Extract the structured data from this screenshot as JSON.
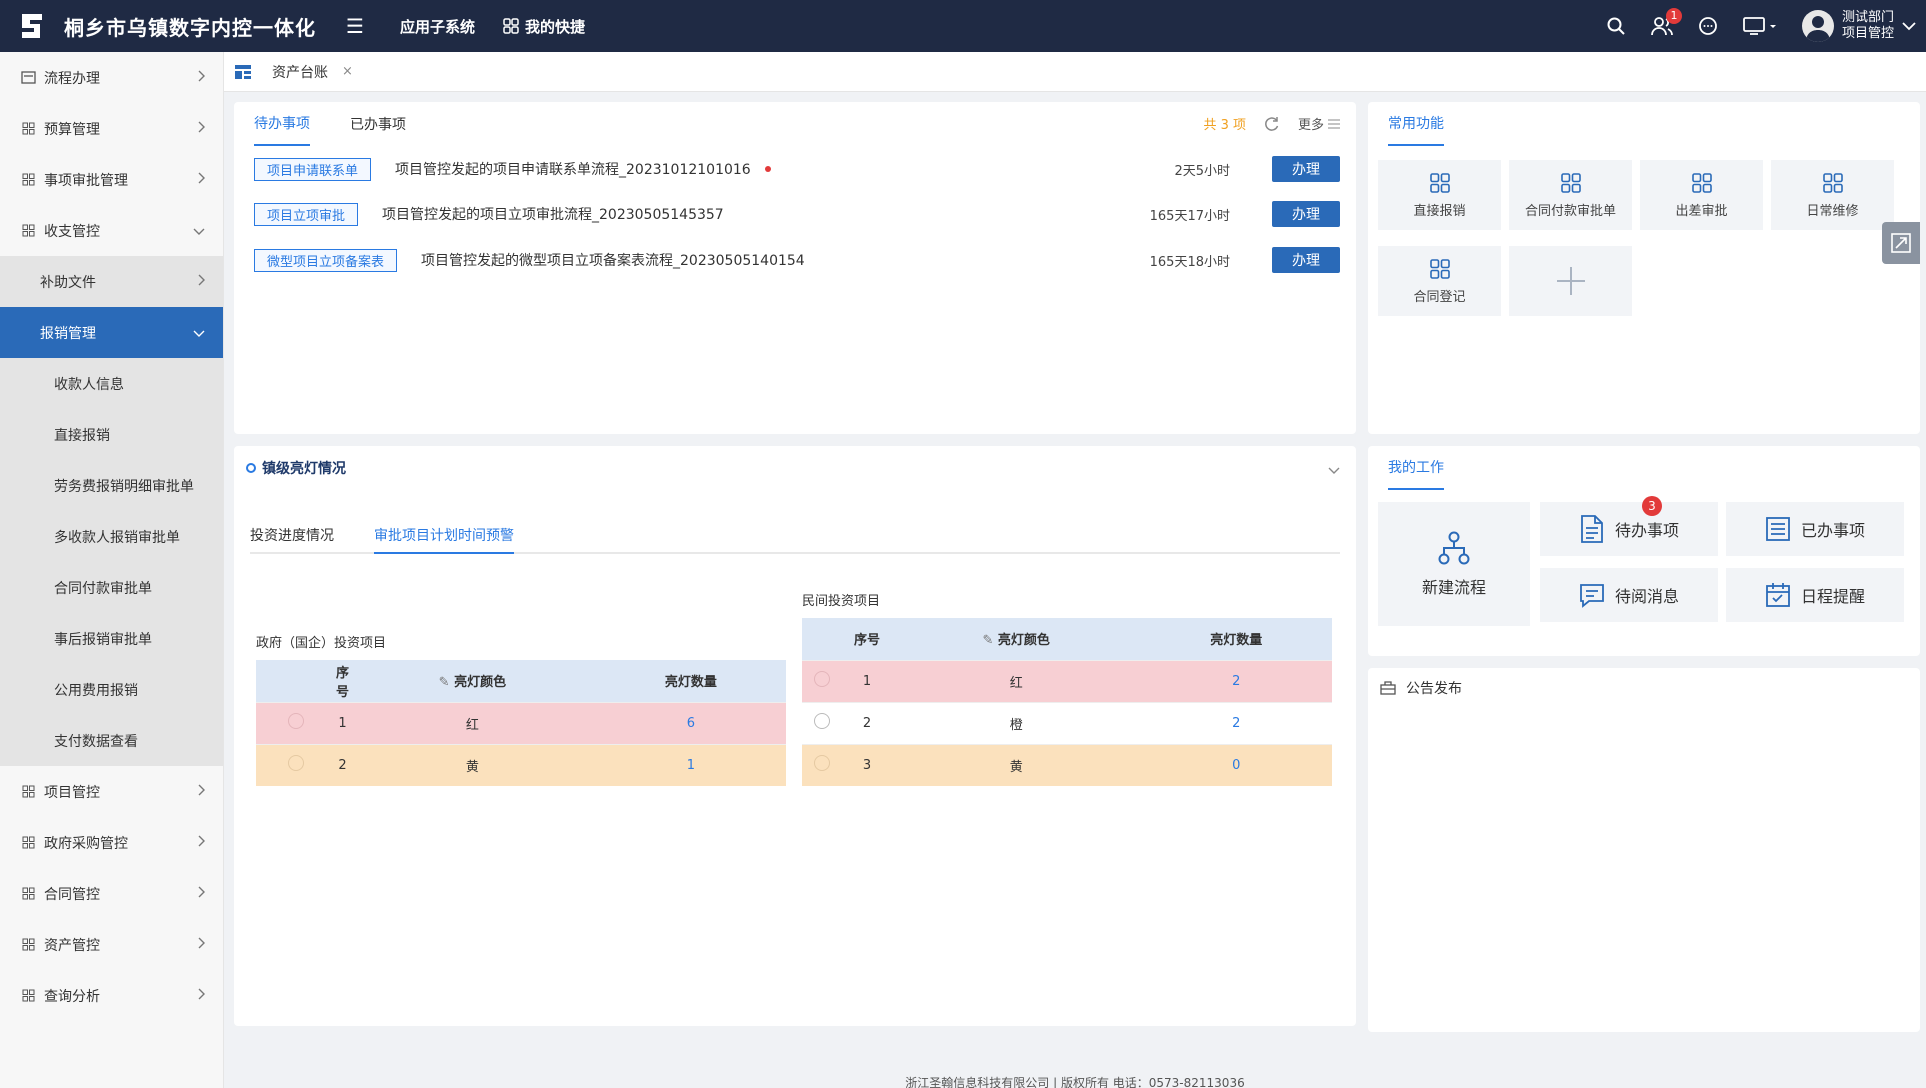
{
  "header": {
    "app_title": "桐乡市乌镇数字内控一体化",
    "nav": [
      "应用子系统",
      "我的快捷"
    ],
    "notification_count": "1",
    "user_dept": "测试部门",
    "user_role": "项目管控"
  },
  "sidebar": {
    "items": [
      {
        "label": "流程办理"
      },
      {
        "label": "预算管理"
      },
      {
        "label": "事项审批管理"
      },
      {
        "label": "收支管控"
      },
      {
        "label": "补助文件"
      },
      {
        "label": "报销管理"
      },
      {
        "label": "收款人信息"
      },
      {
        "label": "直接报销"
      },
      {
        "label": "劳务费报销明细审批单"
      },
      {
        "label": "多收款人报销审批单"
      },
      {
        "label": "合同付款审批单"
      },
      {
        "label": "事后报销审批单"
      },
      {
        "label": "公用费用报销"
      },
      {
        "label": "支付数据查看"
      },
      {
        "label": "项目管控"
      },
      {
        "label": "政府采购管控"
      },
      {
        "label": "合同管控"
      },
      {
        "label": "资产管控"
      },
      {
        "label": "查询分析"
      }
    ]
  },
  "tabbar": {
    "tab_label": "资产台账",
    "close": "×"
  },
  "todo": {
    "tabs": [
      "待办事项",
      "已办事项"
    ],
    "count_text": "共 3 项",
    "more": "更多",
    "rows": [
      {
        "tag": "项目申请联系单",
        "text": "项目管控发起的项目申请联系单流程_20231012101016",
        "time": "2天5小时",
        "action": "办理"
      },
      {
        "tag": "项目立项审批",
        "text": "项目管控发起的项目立项审批流程_20230505145357",
        "time": "165天17小时",
        "action": "办理"
      },
      {
        "tag": "微型项目立项备案表",
        "text": "项目管控发起的微型项目立项备案表流程_20230505140154",
        "time": "165天18小时",
        "action": "办理"
      }
    ]
  },
  "quick": {
    "title": "常用功能",
    "items": [
      "直接报销",
      "合同付款审批单",
      "出差审批",
      "日常维修",
      "合同登记"
    ]
  },
  "lamp": {
    "title": "镇级亮灯情况",
    "tabs": [
      "投资进度情况",
      "审批项目计划时间预警"
    ],
    "gov": {
      "title": "政府（国企）投资项目",
      "headers": [
        "序号",
        "亮灯颜色",
        "亮灯数量"
      ],
      "rows": [
        {
          "no": "1",
          "color": "红",
          "count": "6"
        },
        {
          "no": "2",
          "color": "黄",
          "count": "1"
        }
      ]
    },
    "private": {
      "title": "民间投资项目",
      "headers": [
        "序号",
        "亮灯颜色",
        "亮灯数量"
      ],
      "rows": [
        {
          "no": "1",
          "color": "红",
          "count": "2"
        },
        {
          "no": "2",
          "color": "橙",
          "count": "2"
        },
        {
          "no": "3",
          "color": "黄",
          "count": "0"
        }
      ]
    }
  },
  "work": {
    "title": "我的工作",
    "new_flow": "新建流程",
    "todo": "待办事项",
    "todo_badge": "3",
    "done": "已办事项",
    "unread": "待阅消息",
    "schedule": "日程提醒"
  },
  "notice": {
    "title": "公告发布"
  },
  "footer": {
    "text": "浙江圣翰信息科技有限公司 | 版权所有 电话：0573-82113036"
  },
  "colors": {
    "primary": "#2a6ab8",
    "header_bg": "#1f2a44",
    "accent": "#2a7ae2",
    "red_row": "#f7cfd3",
    "yellow_row": "#fbe1bd"
  }
}
